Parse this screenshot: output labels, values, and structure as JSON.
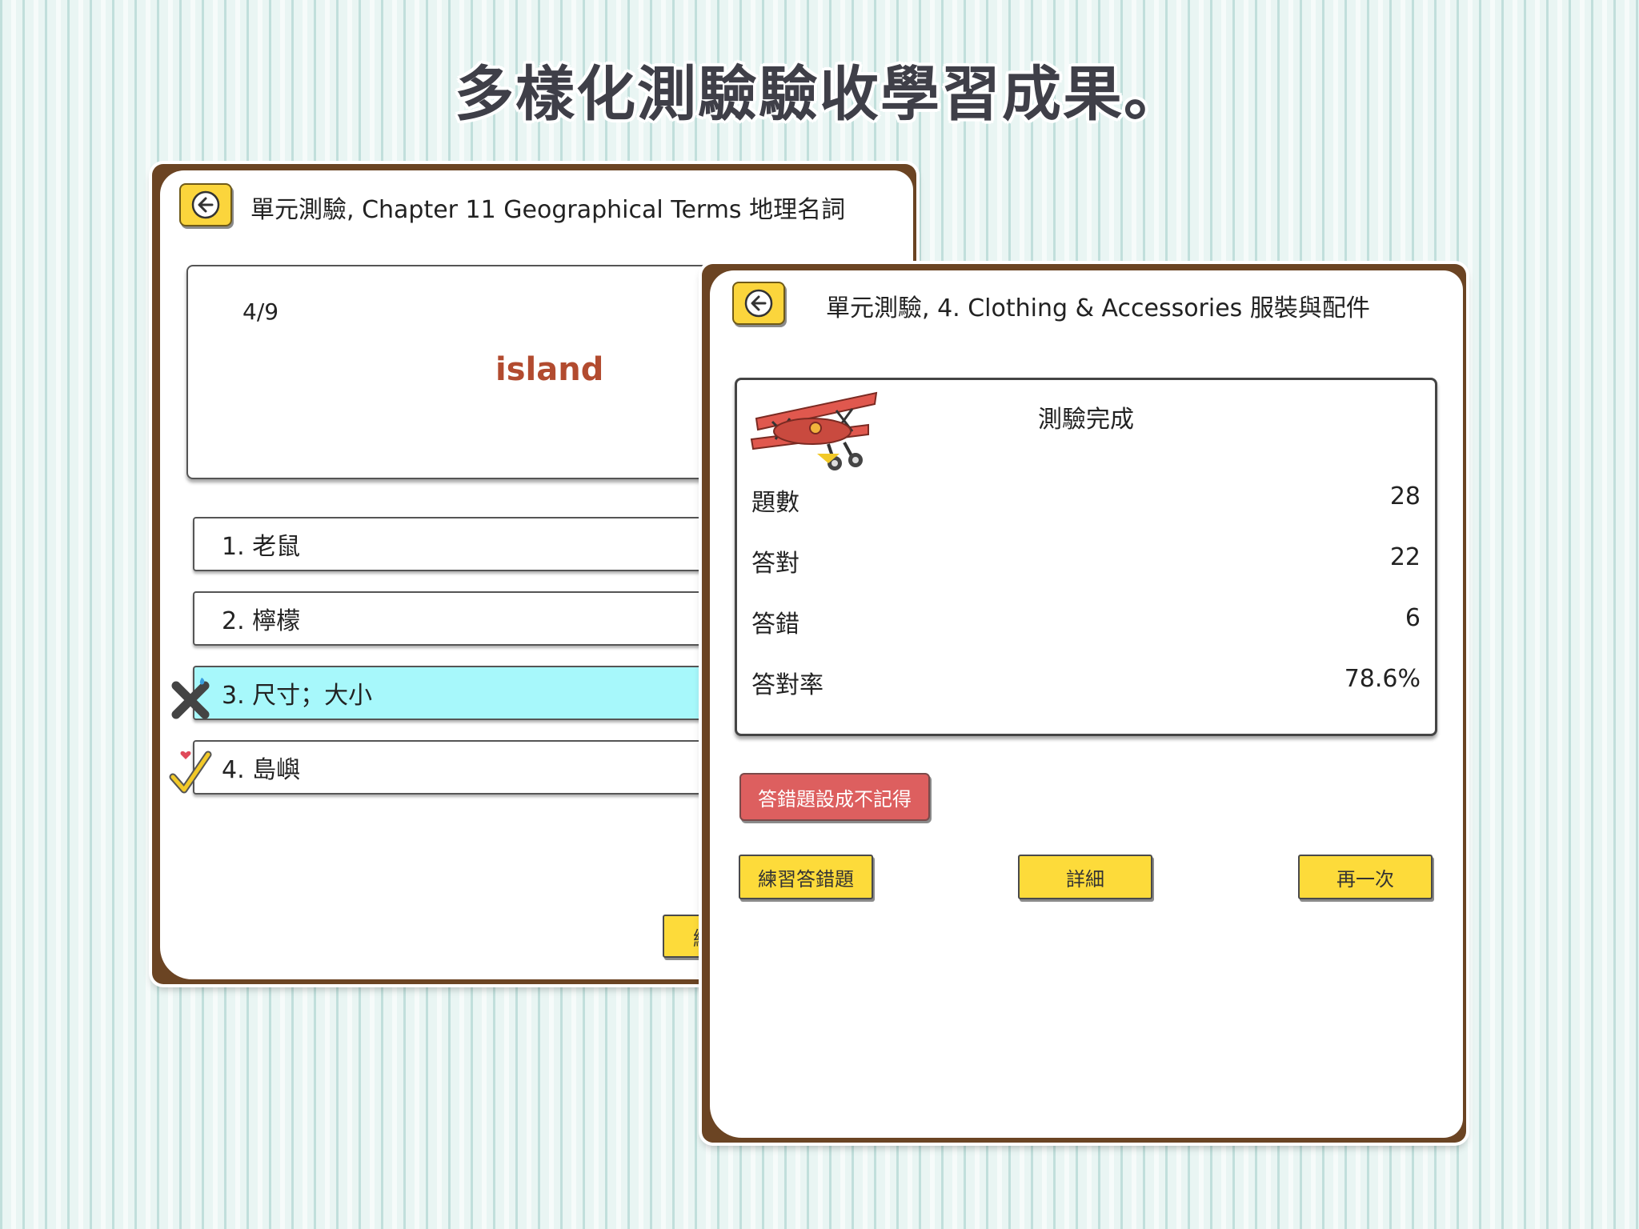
{
  "headline": "多樣化測驗驗收學習成果。",
  "quiz_screen": {
    "title": "單元測驗, Chapter 11 Geographical Terms 地理名詞",
    "progress": "4/9",
    "word": "island",
    "options": [
      {
        "label": "1. 老鼠"
      },
      {
        "label": "2. 檸檬"
      },
      {
        "label": "3. 尺寸；大小"
      },
      {
        "label": "4. 島嶼"
      }
    ],
    "partial_button_label": "繼"
  },
  "result_screen": {
    "title": "單元測驗, 4. Clothing & Accessories 服裝與配件",
    "heading": "測驗完成",
    "stats": [
      {
        "label": "題數",
        "value": "28"
      },
      {
        "label": "答對",
        "value": "22"
      },
      {
        "label": "答錯",
        "value": "6"
      },
      {
        "label": "答對率",
        "value": "78.6%"
      }
    ],
    "forget_button": "答錯題設成不記得",
    "practice_button": "練習答錯題",
    "detail_button": "詳細",
    "again_button": "再一次"
  },
  "colors": {
    "frame": "#6b4423",
    "button_yellow": "#fddb3a",
    "button_red": "#dd5f5f",
    "selected_option": "#a7f8fb",
    "word": "#b24b2f"
  }
}
